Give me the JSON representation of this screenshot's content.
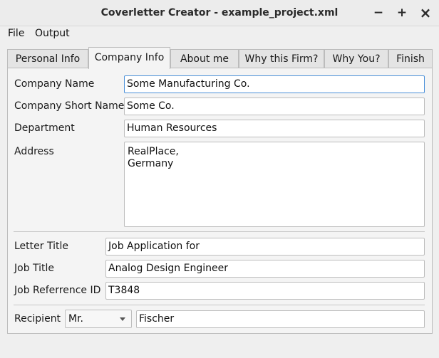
{
  "window": {
    "title": "Coverletter Creator - example_project.xml",
    "minimize_glyph": "−",
    "maximize_glyph": "+",
    "close_glyph": "×"
  },
  "menu": {
    "file": "File",
    "output": "Output"
  },
  "tabs": [
    {
      "label": "Personal Info",
      "active": false
    },
    {
      "label": "Company Info",
      "active": true
    },
    {
      "label": "About me",
      "active": false
    },
    {
      "label": "Why this Firm?",
      "active": false
    },
    {
      "label": "Why You?",
      "active": false
    },
    {
      "label": "Finish",
      "active": false
    }
  ],
  "company": {
    "name_label": "Company Name",
    "name_value": "Some Manufacturing Co.",
    "short_label": "Company Short Name",
    "short_value": "Some Co.",
    "department_label": "Department",
    "department_value": "Human Resources",
    "address_label": "Address",
    "address_value": "RealPlace,\nGermany"
  },
  "letter": {
    "title_label": "Letter Title",
    "title_value": "Job Application for",
    "job_title_label": "Job Title",
    "job_title_value": "Analog Design Engineer",
    "job_ref_label": "Job Referrence ID",
    "job_ref_value": "T3848"
  },
  "recipient": {
    "label": "Recipient",
    "salutation_selected": "Mr.",
    "name_value": "Fischer"
  },
  "colors": {
    "focus_border": "#4a90d9",
    "window_bg": "#efefef"
  }
}
